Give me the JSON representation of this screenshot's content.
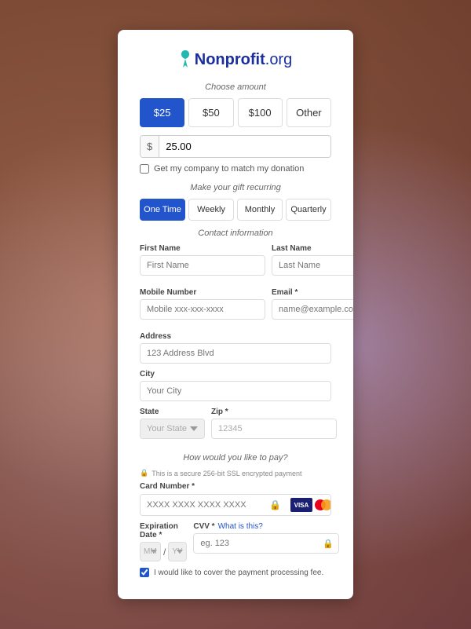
{
  "logo": {
    "ribbon_symbol": "🎗",
    "text_nonprofit": "Nonprofit",
    "text_dot": ".",
    "text_org": "org"
  },
  "choose_amount": {
    "label": "Choose amount",
    "buttons": [
      "$25",
      "$50",
      "$100",
      "Other"
    ],
    "active_index": 0,
    "input_value": "25.00",
    "dollar_sign": "$",
    "match_label": "Get my company to match my donation"
  },
  "recurring": {
    "label": "Make your gift recurring",
    "buttons": [
      "One Time",
      "Weekly",
      "Monthly",
      "Quarterly"
    ],
    "active_index": 0
  },
  "contact": {
    "label": "Contact information",
    "first_name_label": "First Name",
    "first_name_placeholder": "First Name",
    "last_name_label": "Last Name",
    "last_name_placeholder": "Last Name",
    "mobile_label": "Mobile Number",
    "mobile_placeholder": "Mobile xxx-xxx-xxxx",
    "email_label": "Email *",
    "email_placeholder": "name@example.com",
    "address_label": "Address",
    "address_placeholder": "123 Address Blvd",
    "city_label": "City",
    "city_placeholder": "Your City",
    "state_label": "State",
    "state_placeholder": "Your State",
    "zip_label": "Zip *",
    "zip_value": "12345"
  },
  "payment": {
    "label": "How would you like to pay?",
    "ssl_notice": "This is a secure 256-bit SSL encrypted payment",
    "card_number_label": "Card Number *",
    "card_number_placeholder": "XXXX XXXX XXXX XXXX",
    "expiry_label": "Expiration Date *",
    "mm_placeholder": "MM",
    "yy_placeholder": "YY",
    "cvv_label": "CVV *",
    "cvv_what": "What is this?",
    "cvv_placeholder": "eg. 123",
    "processing_fee_label": "I would like to cover the payment processing fee."
  }
}
